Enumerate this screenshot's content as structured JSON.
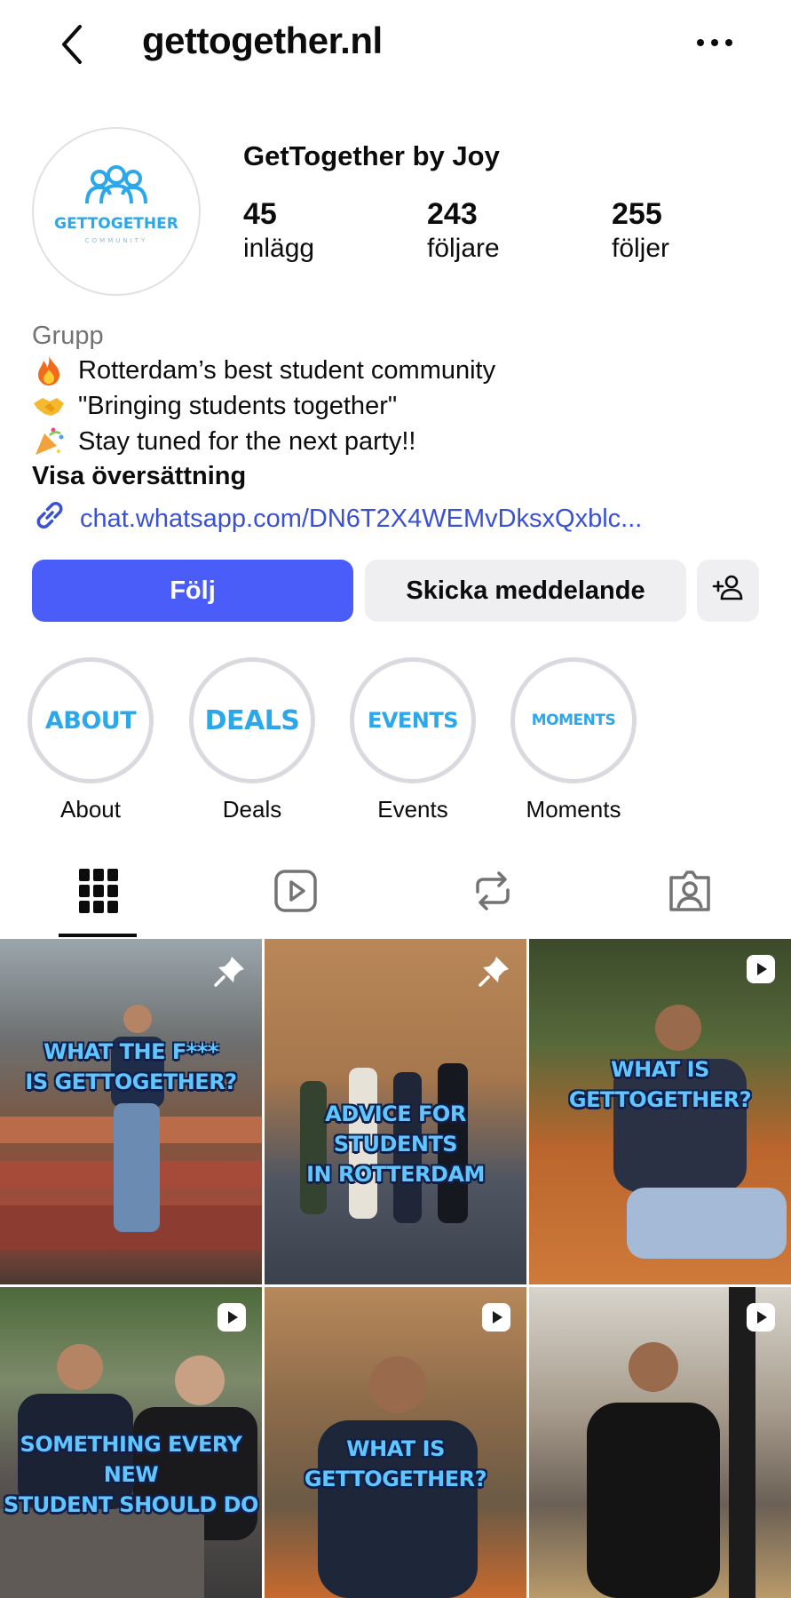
{
  "header": {
    "username": "gettogether.nl"
  },
  "profile": {
    "display_name": "GetTogether by Joy",
    "logo_text": "GETTOGETHER",
    "logo_sub": "COMMUNITY",
    "stats": [
      {
        "value": "45",
        "label": "inlägg"
      },
      {
        "value": "243",
        "label": "följare"
      },
      {
        "value": "255",
        "label": "följer"
      }
    ],
    "category": "Grupp",
    "bio": [
      {
        "icon": "fire-emoji",
        "text": "Rotterdam’s best student community"
      },
      {
        "icon": "handshake-emoji",
        "text": "\"Bringing students together\""
      },
      {
        "icon": "party-popper-emoji",
        "text": "Stay tuned for the next party!!"
      }
    ],
    "translate_label": "Visa översättning",
    "link": "chat.whatsapp.com/DN6T2X4WEMvDksxQxblc..."
  },
  "actions": {
    "follow": "Följ",
    "message": "Skicka meddelande"
  },
  "highlights": [
    {
      "ring": "ABOUT",
      "label": "About"
    },
    {
      "ring": "DEALS",
      "label": "Deals"
    },
    {
      "ring": "EVENTS",
      "label": "Events"
    },
    {
      "ring": "MOMENTS",
      "label": "Moments"
    }
  ],
  "tabs": [
    "grid-icon",
    "reels-icon",
    "reposts-icon",
    "tagged-icon"
  ],
  "posts": [
    {
      "caption_l1": "WHAT THE F***",
      "caption_l2": "IS GETTOGETHER?",
      "badge": "pin-icon"
    },
    {
      "caption_l1": "ADVICE FOR STUDENTS",
      "caption_l2": "IN ROTTERDAM",
      "badge": "pin-icon"
    },
    {
      "caption_l1": "WHAT IS",
      "caption_l2": "GETTOGETHER?",
      "badge": "reel-icon"
    },
    {
      "caption_l1": "SOMETHING EVERY NEW",
      "caption_l2": "STUDENT SHOULD DO",
      "badge": "reel-icon"
    },
    {
      "caption_l1": "WHAT IS",
      "caption_l2": "GETTOGETHER?",
      "badge": "reel-icon"
    },
    {
      "caption_l1": "",
      "caption_l2": "",
      "badge": "reel-icon"
    }
  ],
  "colors": {
    "accent": "#4a5df9",
    "link": "#3a51d6",
    "highlight_text": "#2ba7ea"
  }
}
